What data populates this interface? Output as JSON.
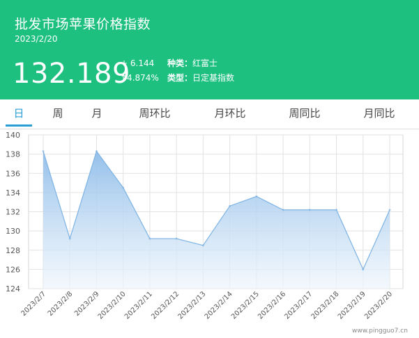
{
  "header": {
    "title": "批发市场苹果价格指数",
    "date": "2023/2/20",
    "price": "132.189",
    "change": "+ 6.144",
    "change_pct": "↑4.874%",
    "variety_label": "种类：",
    "variety": "红富士",
    "type_label": "类型：",
    "type": "日定基指数"
  },
  "tabs": [
    {
      "label": "日"
    },
    {
      "label": "周"
    },
    {
      "label": "月"
    },
    {
      "label": "周环比"
    },
    {
      "label": "月环比"
    },
    {
      "label": "周同比"
    },
    {
      "label": "月同比"
    }
  ],
  "watermark": "www.pingguo7.cn",
  "colors": {
    "header": "#1ec080",
    "active_tab": "#2a9dd6",
    "line": "#7db3e3",
    "fill_top": "#8fbde9"
  },
  "chart_data": {
    "type": "area",
    "categories": [
      "2023/2/7",
      "2023/2/8",
      "2023/2/9",
      "2023/2/10",
      "2023/2/11",
      "2023/2/12",
      "2023/2/13",
      "2023/2/14",
      "2023/2/15",
      "2023/2/16",
      "2023/2/17",
      "2023/2/18",
      "2023/2/19",
      "2023/2/20"
    ],
    "values": [
      138.3,
      129.2,
      138.3,
      134.5,
      129.2,
      129.2,
      128.5,
      132.6,
      133.6,
      132.2,
      132.2,
      132.2,
      126.0,
      132.2
    ],
    "ylim": [
      124,
      140
    ],
    "yticks": [
      124,
      126,
      128,
      130,
      132,
      134,
      136,
      138,
      140
    ],
    "grid": true
  }
}
